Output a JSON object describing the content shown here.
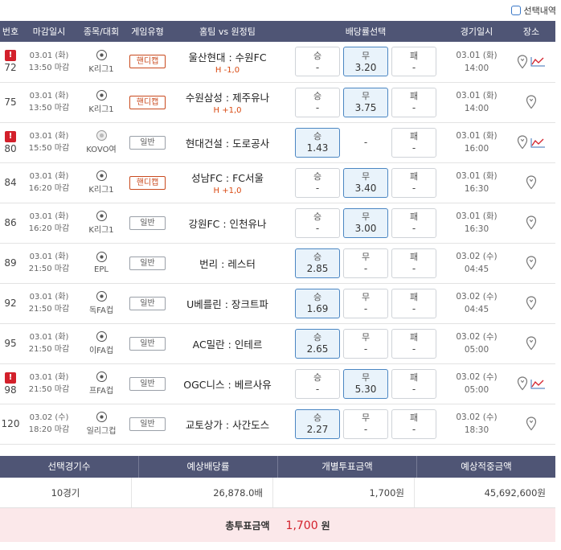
{
  "select_history": {
    "label": "선택내역"
  },
  "headers": [
    "번호",
    "마감일시",
    "종목/대회",
    "게임유형",
    "홈팀 vs 원정팀",
    "배당률선택",
    "경기일시",
    "장소"
  ],
  "games": [
    {
      "alert": true,
      "alert_glyph": "!",
      "num": "72",
      "deadline_date": "03.01 (화)",
      "deadline_time": "13:50 마감",
      "league": "K리그1",
      "type": "핸디캡",
      "type_kind": "handicap",
      "home": "울산현대",
      "away": "수원FC",
      "handicap": "H -1,0",
      "odds": [
        {
          "label": "승",
          "value": "-",
          "sel": false
        },
        {
          "label": "무",
          "value": "3.20",
          "sel": true
        },
        {
          "label": "패",
          "value": "-",
          "sel": false
        }
      ],
      "game_date": "03.01 (화)",
      "game_time": "14:00",
      "trend": true
    },
    {
      "alert": false,
      "alert_glyph": "",
      "num": "75",
      "deadline_date": "03.01 (화)",
      "deadline_time": "13:50 마감",
      "league": "K리그1",
      "type": "핸디캡",
      "type_kind": "handicap",
      "home": "수원삼성",
      "away": "제주유나",
      "handicap": "H +1,0",
      "odds": [
        {
          "label": "승",
          "value": "-",
          "sel": false
        },
        {
          "label": "무",
          "value": "3.75",
          "sel": true
        },
        {
          "label": "패",
          "value": "-",
          "sel": false
        }
      ],
      "game_date": "03.01 (화)",
      "game_time": "14:00",
      "trend": false
    },
    {
      "alert": true,
      "alert_glyph": "!",
      "num": "80",
      "deadline_date": "03.01 (화)",
      "deadline_time": "15:50 마감",
      "league": "KOVO여",
      "type": "일반",
      "type_kind": "normal",
      "home": "현대건설",
      "away": "도로공사",
      "handicap": "",
      "odds": [
        {
          "label": "승",
          "value": "1.43",
          "sel": true
        },
        {
          "label": "",
          "value": "-",
          "sel": false,
          "empty": true
        },
        {
          "label": "패",
          "value": "-",
          "sel": false
        }
      ],
      "game_date": "03.01 (화)",
      "game_time": "16:00",
      "trend": true,
      "volley": true
    },
    {
      "alert": false,
      "alert_glyph": "",
      "num": "84",
      "deadline_date": "03.01 (화)",
      "deadline_time": "16:20 마감",
      "league": "K리그1",
      "type": "핸디캡",
      "type_kind": "handicap",
      "home": "성남FC",
      "away": "FC서울",
      "handicap": "H +1,0",
      "odds": [
        {
          "label": "승",
          "value": "-",
          "sel": false
        },
        {
          "label": "무",
          "value": "3.40",
          "sel": true
        },
        {
          "label": "패",
          "value": "-",
          "sel": false
        }
      ],
      "game_date": "03.01 (화)",
      "game_time": "16:30",
      "trend": false
    },
    {
      "alert": false,
      "alert_glyph": "",
      "num": "86",
      "deadline_date": "03.01 (화)",
      "deadline_time": "16:20 마감",
      "league": "K리그1",
      "type": "일반",
      "type_kind": "normal",
      "home": "강원FC",
      "away": "인천유나",
      "handicap": "",
      "odds": [
        {
          "label": "승",
          "value": "-",
          "sel": false
        },
        {
          "label": "무",
          "value": "3.00",
          "sel": true
        },
        {
          "label": "패",
          "value": "-",
          "sel": false
        }
      ],
      "game_date": "03.01 (화)",
      "game_time": "16:30",
      "trend": false
    },
    {
      "alert": false,
      "alert_glyph": "",
      "num": "89",
      "deadline_date": "03.01 (화)",
      "deadline_time": "21:50 마감",
      "league": "EPL",
      "type": "일반",
      "type_kind": "normal",
      "home": "번리",
      "away": "레스터",
      "handicap": "",
      "odds": [
        {
          "label": "승",
          "value": "2.85",
          "sel": true
        },
        {
          "label": "무",
          "value": "-",
          "sel": false
        },
        {
          "label": "패",
          "value": "-",
          "sel": false
        }
      ],
      "game_date": "03.02 (수)",
      "game_time": "04:45",
      "trend": false
    },
    {
      "alert": false,
      "alert_glyph": "",
      "num": "92",
      "deadline_date": "03.01 (화)",
      "deadline_time": "21:50 마감",
      "league": "독FA컵",
      "type": "일반",
      "type_kind": "normal",
      "home": "U베를린",
      "away": "장크트파",
      "handicap": "",
      "odds": [
        {
          "label": "승",
          "value": "1.69",
          "sel": true
        },
        {
          "label": "무",
          "value": "-",
          "sel": false
        },
        {
          "label": "패",
          "value": "-",
          "sel": false
        }
      ],
      "game_date": "03.02 (수)",
      "game_time": "04:45",
      "trend": false
    },
    {
      "alert": false,
      "alert_glyph": "",
      "num": "95",
      "deadline_date": "03.01 (화)",
      "deadline_time": "21:50 마감",
      "league": "이FA컵",
      "type": "일반",
      "type_kind": "normal",
      "home": "AC밀란",
      "away": "인테르",
      "handicap": "",
      "odds": [
        {
          "label": "승",
          "value": "2.65",
          "sel": true
        },
        {
          "label": "무",
          "value": "-",
          "sel": false
        },
        {
          "label": "패",
          "value": "-",
          "sel": false
        }
      ],
      "game_date": "03.02 (수)",
      "game_time": "05:00",
      "trend": false
    },
    {
      "alert": true,
      "alert_glyph": "!",
      "num": "98",
      "deadline_date": "03.01 (화)",
      "deadline_time": "21:50 마감",
      "league": "프FA컵",
      "type": "일반",
      "type_kind": "normal",
      "home": "OGC니스",
      "away": "베르사유",
      "handicap": "",
      "odds": [
        {
          "label": "승",
          "value": "-",
          "sel": false
        },
        {
          "label": "무",
          "value": "5.30",
          "sel": true
        },
        {
          "label": "패",
          "value": "-",
          "sel": false
        }
      ],
      "game_date": "03.02 (수)",
      "game_time": "05:00",
      "trend": true
    },
    {
      "alert": false,
      "alert_glyph": "",
      "num": "120",
      "deadline_date": "03.02 (수)",
      "deadline_time": "18:20 마감",
      "league": "일리그컵",
      "type": "일반",
      "type_kind": "normal",
      "home": "교토상가",
      "away": "사간도스",
      "handicap": "",
      "odds": [
        {
          "label": "승",
          "value": "2.27",
          "sel": true
        },
        {
          "label": "무",
          "value": "-",
          "sel": false
        },
        {
          "label": "패",
          "value": "-",
          "sel": false
        }
      ],
      "game_date": "03.02 (수)",
      "game_time": "18:30",
      "trend": false
    }
  ],
  "summary": {
    "headers": [
      "선택경기수",
      "예상배당률",
      "개별투표금액",
      "예상적중금액"
    ],
    "values": [
      "10경기",
      "26,878.0배",
      "1,700원",
      "45,692,600원"
    ],
    "total_label": "총투표금액",
    "total_amount": "1,700",
    "total_unit": "원"
  },
  "colors": {
    "header_bg": "#4f5575",
    "accent_red": "#d3202b",
    "selected_odd_bg": "#e9f3fb",
    "handicap": "#d94a12"
  }
}
